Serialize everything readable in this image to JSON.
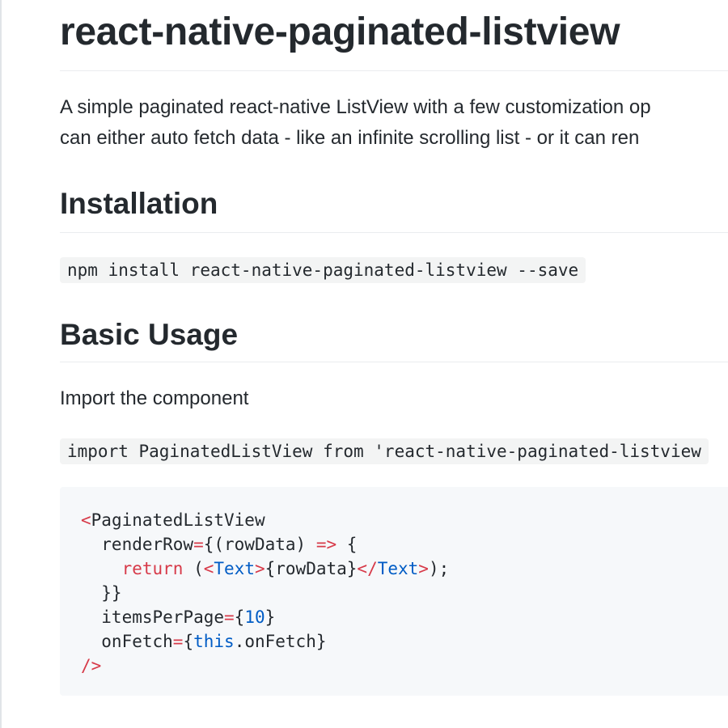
{
  "title": "react-native-paginated-listview",
  "intro": {
    "line1": "A simple paginated react-native ListView with a few customization op",
    "line2": "can either auto fetch data - like an infinite scrolling list - or it can ren"
  },
  "installation": {
    "heading": "Installation",
    "command": "npm install react-native-paginated-listview --save"
  },
  "basic_usage": {
    "heading": "Basic Usage",
    "import_text": "Import the component",
    "import_code": "import PaginatedListView from 'react-native-paginated-listview"
  },
  "code_block": {
    "lines": [
      [
        {
          "t": "<",
          "c": "red"
        },
        {
          "t": "PaginatedListView",
          "c": "plain"
        }
      ],
      [
        {
          "t": "  renderRow",
          "c": "plain"
        },
        {
          "t": "=",
          "c": "red"
        },
        {
          "t": "{(rowData) ",
          "c": "plain"
        },
        {
          "t": "=>",
          "c": "red"
        },
        {
          "t": " {",
          "c": "plain"
        }
      ],
      [
        {
          "t": "    ",
          "c": "plain"
        },
        {
          "t": "return",
          "c": "red"
        },
        {
          "t": " (",
          "c": "plain"
        },
        {
          "t": "<",
          "c": "red"
        },
        {
          "t": "Text",
          "c": "blue"
        },
        {
          "t": ">",
          "c": "red"
        },
        {
          "t": "{rowData}",
          "c": "plain"
        },
        {
          "t": "</",
          "c": "red"
        },
        {
          "t": "Text",
          "c": "blue"
        },
        {
          "t": ">",
          "c": "red"
        },
        {
          "t": ");",
          "c": "plain"
        }
      ],
      [
        {
          "t": "  }}",
          "c": "plain"
        }
      ],
      [
        {
          "t": "  itemsPerPage",
          "c": "plain"
        },
        {
          "t": "=",
          "c": "red"
        },
        {
          "t": "{",
          "c": "plain"
        },
        {
          "t": "10",
          "c": "blue"
        },
        {
          "t": "}",
          "c": "plain"
        }
      ],
      [
        {
          "t": "  onFetch",
          "c": "plain"
        },
        {
          "t": "=",
          "c": "red"
        },
        {
          "t": "{",
          "c": "plain"
        },
        {
          "t": "this",
          "c": "blue"
        },
        {
          "t": ".onFetch}",
          "c": "plain"
        }
      ],
      [
        {
          "t": "/>",
          "c": "red"
        }
      ]
    ]
  },
  "colors": {
    "text": "#24292e",
    "keyword_red": "#d73a49",
    "constant_blue": "#005cc5",
    "code_bg": "#f6f8fa",
    "rule": "#eaecef"
  }
}
